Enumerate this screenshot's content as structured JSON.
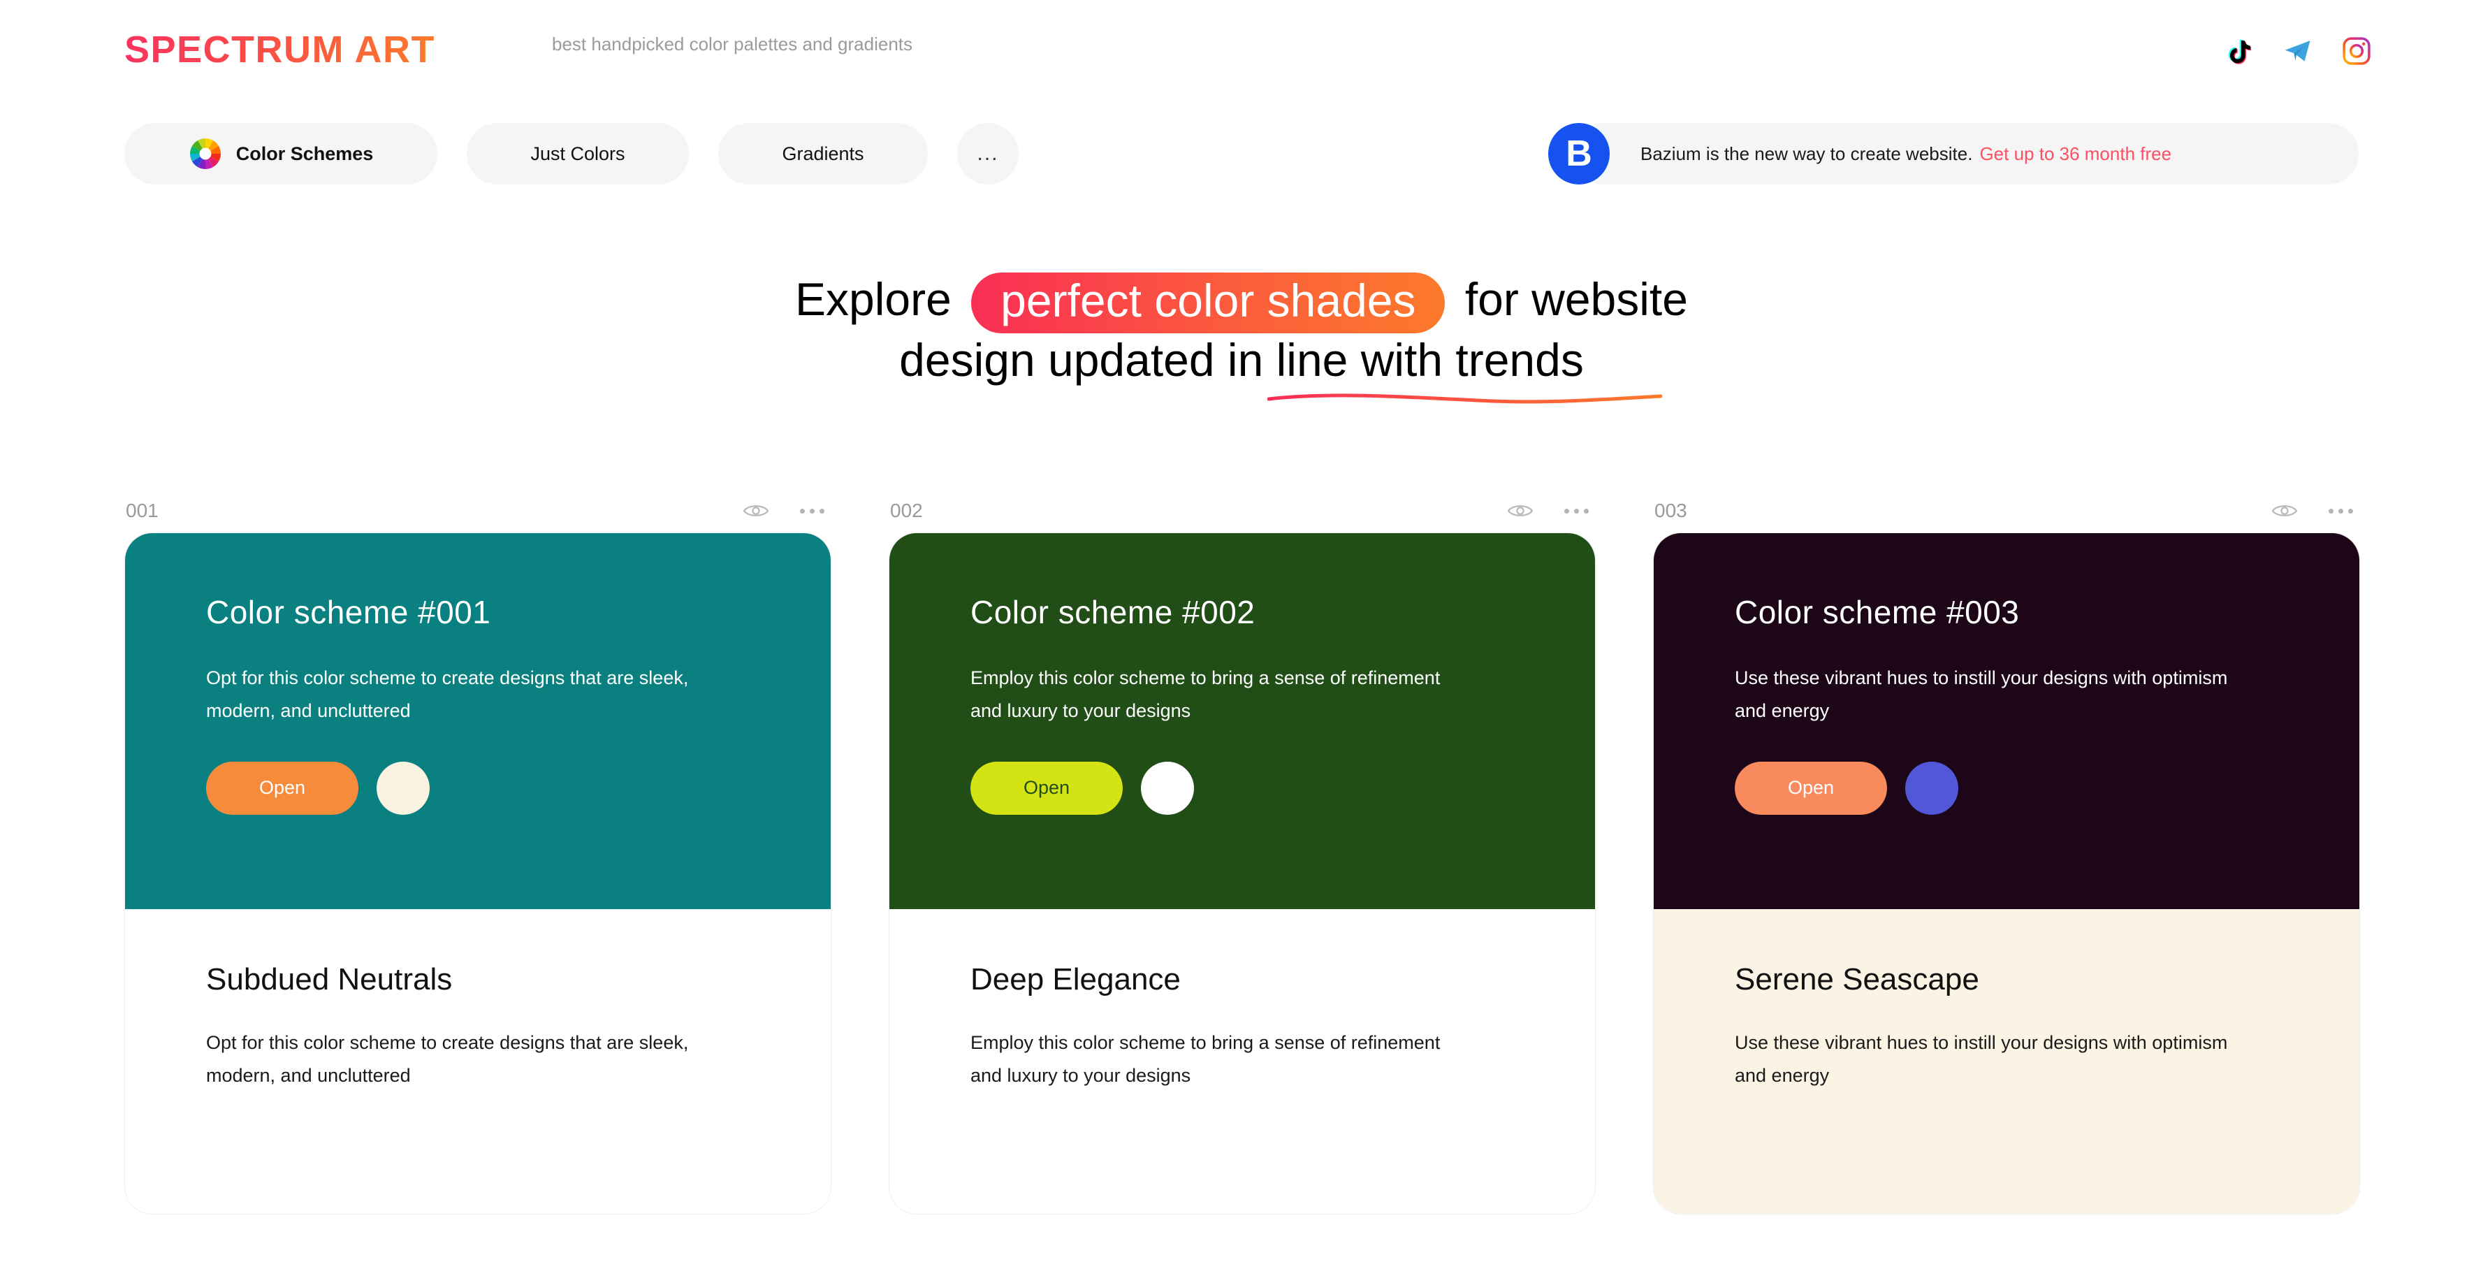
{
  "header": {
    "logo": "SPECTRUM ART",
    "tagline": "best handpicked color palettes and gradients",
    "logo_gradient_from": "#F9335F",
    "logo_gradient_to": "#FB7B2A",
    "socials": [
      {
        "name": "tiktok-icon",
        "label": "TikTok"
      },
      {
        "name": "telegram-icon",
        "label": "Telegram"
      },
      {
        "name": "instagram-icon",
        "label": "Instagram"
      }
    ]
  },
  "nav": {
    "tabs": [
      {
        "label": "Color Schemes",
        "active": true,
        "icon": "color-wheel-icon"
      },
      {
        "label": "Just Colors",
        "active": false
      },
      {
        "label": "Gradients",
        "active": false
      },
      {
        "label": "...",
        "active": false
      }
    ]
  },
  "promo": {
    "badge": "B",
    "badge_color": "#1652F0",
    "text": "Bazium is the new way to create website.",
    "link": "Get up to 36 month free",
    "link_color": "#FB4F63"
  },
  "hero": {
    "line1_before": "Explore",
    "highlight": "perfect color shades",
    "line1_after": "for website",
    "line2": "design updated in line with trends",
    "highlight_gradient_from": "#FA2E55",
    "highlight_gradient_to": "#FC7A2C"
  },
  "cards": [
    {
      "number": "001",
      "title": "Color scheme #001",
      "subtitle": "Opt for this color scheme to create designs that are sleek, modern, and uncluttered",
      "open_label": "Open",
      "name": "Subdued Neutrals",
      "description": "Opt for this color scheme to create designs that are sleek, modern, and uncluttered",
      "top_bg": "#0B8080",
      "bottom_bg": "#FFFFFF",
      "button_bg": "#F68B3C",
      "button_text_color": "#FFFFFF",
      "swatch": "#FBF3E2",
      "eye_icon": "eye-icon",
      "more_icon": "more-dots-icon"
    },
    {
      "number": "002",
      "title": "Color scheme #002",
      "subtitle": "Employ this color scheme to bring a sense of refinement and luxury to your designs",
      "open_label": "Open",
      "name": "Deep Elegance",
      "description": "Employ this color scheme to bring a sense of refinement and luxury to your designs",
      "top_bg": "#214D17",
      "bottom_bg": "#FFFFFF",
      "button_bg": "#D4E314",
      "button_text_color": "#214D17",
      "swatch": "#FFFFFF",
      "eye_icon": "eye-icon",
      "more_icon": "more-dots-icon"
    },
    {
      "number": "003",
      "title": "Color scheme #003",
      "subtitle": "Use these vibrant hues to instill your designs with optimism and energy",
      "open_label": "Open",
      "name": "Serene Seascape",
      "description": "Use these vibrant hues to instill your designs with optimism and energy",
      "top_bg": "#1D0618",
      "bottom_bg": "#FBF4E4",
      "button_bg": "#F98A5E",
      "button_text_color": "#FFFFFF",
      "swatch": "#5157D6",
      "eye_icon": "eye-icon",
      "more_icon": "more-dots-icon"
    }
  ]
}
